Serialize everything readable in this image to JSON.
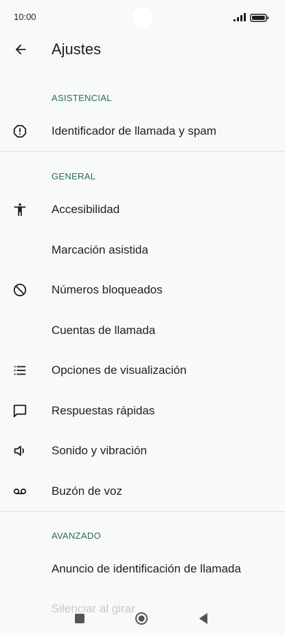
{
  "status": {
    "time": "10:00"
  },
  "header": {
    "title": "Ajustes"
  },
  "sections": [
    {
      "title": "ASISTENCIAL",
      "items": [
        {
          "label": "Identificador de llamada y spam",
          "icon": "caution-icon"
        }
      ]
    },
    {
      "title": "GENERAL",
      "items": [
        {
          "label": "Accesibilidad",
          "icon": "accessibility-icon"
        },
        {
          "label": "Marcación asistida",
          "icon": ""
        },
        {
          "label": "Números bloqueados",
          "icon": "block-icon"
        },
        {
          "label": "Cuentas de llamada",
          "icon": ""
        },
        {
          "label": "Opciones de visualización",
          "icon": "list-icon"
        },
        {
          "label": "Respuestas rápidas",
          "icon": "message-icon"
        },
        {
          "label": "Sonido y vibración",
          "icon": "volume-icon"
        },
        {
          "label": "Buzón de voz",
          "icon": "voicemail-icon"
        }
      ]
    },
    {
      "title": "AVANZADO",
      "items": [
        {
          "label": "Anuncio de identificación de llamada",
          "icon": ""
        }
      ]
    }
  ],
  "partial_item": "Silenciar al girar",
  "colors": {
    "background": "#f8faf9",
    "accent": "#2b6b5a",
    "divider": "#dde3e0"
  }
}
